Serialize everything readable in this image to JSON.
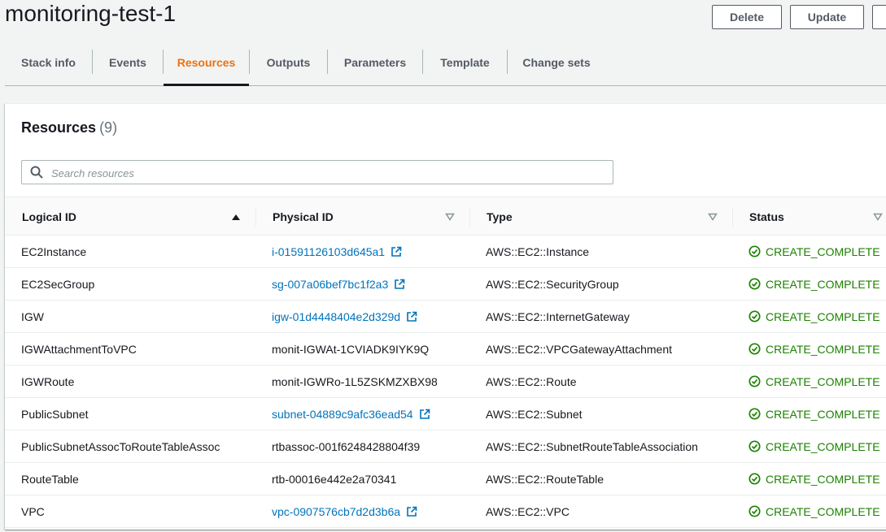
{
  "header": {
    "title": "monitoring-test-1",
    "delete_label": "Delete",
    "update_label": "Update"
  },
  "tabs": [
    {
      "label": "Stack info"
    },
    {
      "label": "Events"
    },
    {
      "label": "Resources",
      "active": true
    },
    {
      "label": "Outputs"
    },
    {
      "label": "Parameters"
    },
    {
      "label": "Template"
    },
    {
      "label": "Change sets"
    }
  ],
  "resources": {
    "title": "Resources",
    "count": "(9)",
    "search_placeholder": "Search resources",
    "columns": [
      {
        "label": "Logical ID",
        "sort": "ascending"
      },
      {
        "label": "Physical ID",
        "sort": "none"
      },
      {
        "label": "Type",
        "sort": "none"
      },
      {
        "label": "Status",
        "sort": "none"
      }
    ],
    "rows": [
      {
        "logical_id": "EC2Instance",
        "physical_id": "i-01591126103d645a1",
        "linked": true,
        "type": "AWS::EC2::Instance",
        "status": "CREATE_COMPLETE"
      },
      {
        "logical_id": "EC2SecGroup",
        "physical_id": "sg-007a06bef7bc1f2a3",
        "linked": true,
        "type": "AWS::EC2::SecurityGroup",
        "status": "CREATE_COMPLETE"
      },
      {
        "logical_id": "IGW",
        "physical_id": "igw-01d4448404e2d329d",
        "linked": true,
        "type": "AWS::EC2::InternetGateway",
        "status": "CREATE_COMPLETE"
      },
      {
        "logical_id": "IGWAttachmentToVPC",
        "physical_id": "monit-IGWAt-1CVIADK9IYK9Q",
        "linked": false,
        "type": "AWS::EC2::VPCGatewayAttachment",
        "status": "CREATE_COMPLETE"
      },
      {
        "logical_id": "IGWRoute",
        "physical_id": "monit-IGWRo-1L5ZSKMZXBX98",
        "linked": false,
        "type": "AWS::EC2::Route",
        "status": "CREATE_COMPLETE"
      },
      {
        "logical_id": "PublicSubnet",
        "physical_id": "subnet-04889c9afc36ead54",
        "linked": true,
        "type": "AWS::EC2::Subnet",
        "status": "CREATE_COMPLETE"
      },
      {
        "logical_id": "PublicSubnetAssocToRouteTableAssoc",
        "physical_id": "rtbassoc-001f6248428804f39",
        "linked": false,
        "type": "AWS::EC2::SubnetRouteTableAssociation",
        "status": "CREATE_COMPLETE"
      },
      {
        "logical_id": "RouteTable",
        "physical_id": "rtb-00016e442e2a70341",
        "linked": false,
        "type": "AWS::EC2::RouteTable",
        "status": "CREATE_COMPLETE"
      },
      {
        "logical_id": "VPC",
        "physical_id": "vpc-0907576cb7d2d3b6a",
        "linked": true,
        "type": "AWS::EC2::VPC",
        "status": "CREATE_COMPLETE"
      }
    ]
  },
  "icons": {
    "search": "search-icon",
    "external_link": "external-link-icon",
    "status_ok": "check-circle-icon",
    "sort_asc": "sort-ascending-icon",
    "sort_none": "sort-icon"
  },
  "colors": {
    "accent": "#ec7211",
    "link": "#0073bb",
    "success": "#1d8102",
    "text": "#16191f"
  }
}
